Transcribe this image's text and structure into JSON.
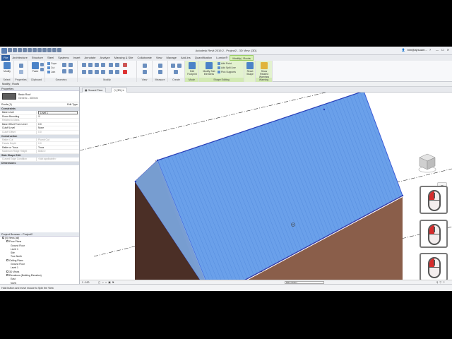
{
  "app": {
    "title": "Autodesk Revit 2019.2 - Project2 - 3D View: {3D}",
    "user": "bim@ajrsuam...",
    "help": "?"
  },
  "ribbon_tabs": [
    "File",
    "Architecture",
    "Structure",
    "Steel",
    "Systems",
    "Insert",
    "Annotate",
    "Analyze",
    "Massing & Site",
    "Collaborate",
    "View",
    "Manage",
    "Add-Ins",
    "Quantification",
    "Lumion®",
    "Modify | Roofs"
  ],
  "ribbon": {
    "modify": "Modify",
    "paste": "Paste",
    "cope": "Cope",
    "cut": "Cut",
    "join": "Join",
    "edit_footprint": "Edit Footprint",
    "modify_subelements": "Modify Sub Elements",
    "add_point": "Add Point",
    "add_split_line": "Add Split Line",
    "pick_supports": "Pick Supports",
    "reset_shape": "Reset Shape",
    "show_related_warnings": "Show Related Warnings",
    "panels": {
      "select": "Select",
      "properties": "Properties",
      "clipboard": "Clipboard",
      "geometry": "Geometry",
      "modify": "Modify",
      "view": "View",
      "measure": "Measure",
      "create": "Create",
      "mode": "Mode",
      "shape_editing": "Shape Editing",
      "warning": "Warning"
    }
  },
  "context_bar": "Modify | Roofs",
  "properties": {
    "title": "Properties",
    "type_name": "Basic Roof",
    "type_sub": "Generic - 400mm",
    "selector": "Roofs (1)",
    "edit_type": "Edit Type",
    "groups": {
      "constraints": "Constraints",
      "construction": "Construction",
      "dims": "Dimensions"
    },
    "constraints": [
      {
        "k": "Base Level",
        "v": "Level 1",
        "box": true
      },
      {
        "k": "Room Bounding",
        "v": "☑",
        "box": false
      },
      {
        "k": "Related to Mass",
        "v": "",
        "box": false,
        "grey": true
      },
      {
        "k": "Base Offset From Level",
        "v": "0.0",
        "box": false
      },
      {
        "k": "Cutoff Level",
        "v": "None",
        "box": false
      },
      {
        "k": "Cutoff Offset",
        "v": "0.0",
        "box": false,
        "grey": true
      }
    ],
    "construction": [
      {
        "k": "Rafter Cut",
        "v": "Plumb Cut",
        "grey": true
      },
      {
        "k": "Fascia Depth",
        "v": "0.0",
        "grey": true
      },
      {
        "k": "Rafter or Truss",
        "v": "Truss"
      },
      {
        "k": "Maximum Ridge Height",
        "v": "6660.0",
        "grey": true
      }
    ],
    "slab_group": "Slab Shape Edit",
    "slab": [
      {
        "k": "Curved Edge Condition",
        "v": "<Not applicable>",
        "grey": true
      }
    ],
    "help_link": "Properties help",
    "apply": "Apply"
  },
  "browser": {
    "title": "Project Browser - Project2",
    "items": [
      {
        "t": "[0] Views (all)",
        "d": 0
      },
      {
        "t": "Floor Plans",
        "d": 1
      },
      {
        "t": "Ground Floor",
        "d": 2
      },
      {
        "t": "Level 1",
        "d": 2
      },
      {
        "t": "Site",
        "d": 2
      },
      {
        "t": "True North",
        "d": 2
      },
      {
        "t": "Ceiling Plans",
        "d": 1
      },
      {
        "t": "Ground Floor",
        "d": 2
      },
      {
        "t": "Level 1",
        "d": 2
      },
      {
        "t": "3D Views",
        "d": 1
      },
      {
        "t": "Elevations (Building Elevation)",
        "d": 1
      },
      {
        "t": "East",
        "d": 2
      },
      {
        "t": "North",
        "d": 2
      },
      {
        "t": "South",
        "d": 2
      },
      {
        "t": "West",
        "d": 2
      },
      {
        "t": "Sections (Building Section)",
        "d": 1
      },
      {
        "t": "Section 1",
        "d": 2
      },
      {
        "t": "Legends",
        "d": 0
      },
      {
        "t": "Schedules/Quantities (all)",
        "d": 0
      },
      {
        "t": "Door Schedule",
        "d": 1
      },
      {
        "t": "Window Schedule",
        "d": 1
      },
      {
        "t": "Sheets (all)",
        "d": 0
      }
    ]
  },
  "view_tabs": [
    "Ground Floor",
    "{3D}"
  ],
  "view_scale": "1 : 100",
  "model_selector": "Main Model",
  "status": "Hold button and move mouse to Spin the View"
}
